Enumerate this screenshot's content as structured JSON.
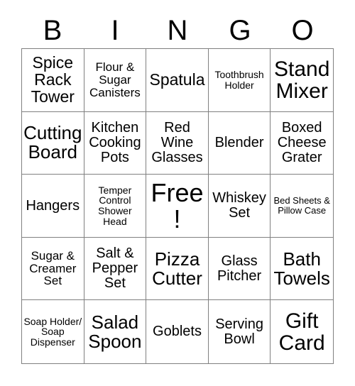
{
  "header": {
    "letters": [
      "B",
      "I",
      "N",
      "G",
      "O"
    ]
  },
  "grid": {
    "rows": 5,
    "columns": 5,
    "border_color": "#808080",
    "background_color": "#ffffff",
    "text_color": "#000000",
    "cells": [
      {
        "text": "Spice Rack Tower",
        "size": "l"
      },
      {
        "text": "Flour & Sugar Canisters",
        "size": "s"
      },
      {
        "text": "Spatula",
        "size": "l"
      },
      {
        "text": "Toothbrush Holder",
        "size": "xs"
      },
      {
        "text": "Stand Mixer",
        "size": "xxl"
      },
      {
        "text": "Cutting Board",
        "size": "xl"
      },
      {
        "text": "Kitchen Cooking Pots",
        "size": "m"
      },
      {
        "text": "Red Wine Glasses",
        "size": "m"
      },
      {
        "text": "Blender",
        "size": "m"
      },
      {
        "text": "Boxed Cheese Grater",
        "size": "m"
      },
      {
        "text": "Hangers",
        "size": "m"
      },
      {
        "text": "Temper Control Shower Head",
        "size": "xs"
      },
      {
        "text": "Free!",
        "size": "free"
      },
      {
        "text": "Whiskey Set",
        "size": "m"
      },
      {
        "text": "Bed Sheets & Pillow Case",
        "size": "xxs"
      },
      {
        "text": "Sugar & Creamer Set",
        "size": "s"
      },
      {
        "text": "Salt & Pepper Set",
        "size": "m"
      },
      {
        "text": "Pizza Cutter",
        "size": "xl"
      },
      {
        "text": "Glass Pitcher",
        "size": "m"
      },
      {
        "text": "Bath Towels",
        "size": "xl"
      },
      {
        "text": "Soap Holder/ Soap Dispenser",
        "size": "xs"
      },
      {
        "text": "Salad Spoon",
        "size": "xl"
      },
      {
        "text": "Goblets",
        "size": "m"
      },
      {
        "text": "Serving Bowl",
        "size": "m"
      },
      {
        "text": "Gift Card",
        "size": "xxl"
      }
    ]
  }
}
